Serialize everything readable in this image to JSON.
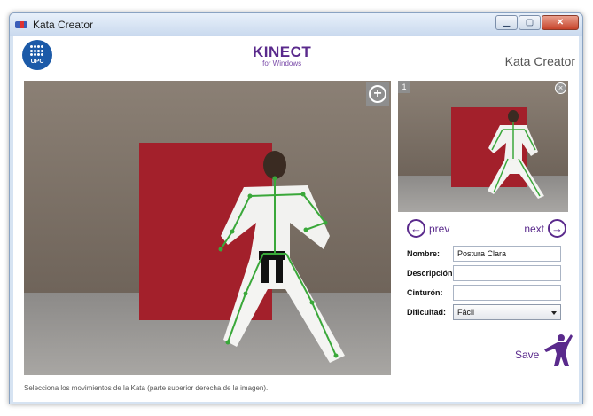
{
  "window": {
    "title": "Kata Creator",
    "controls": {
      "minimize": "▁",
      "maximize": "▢",
      "close": "✕"
    }
  },
  "header": {
    "logo_text": "UPC",
    "kinect_title": "KINECT",
    "kinect_subtitle": "for Windows",
    "app_title": "Kata Creator"
  },
  "main_view": {
    "add_icon": "plus-circle-icon",
    "add_symbol": "+"
  },
  "preview": {
    "index": "1",
    "close_symbol": "×"
  },
  "navigation": {
    "prev_label": "prev",
    "next_label": "next",
    "prev_symbol": "←",
    "next_symbol": "→"
  },
  "form": {
    "nombre_label": "Nombre:",
    "nombre_value": "Postura Clara",
    "descripcion_label": "Descripción:",
    "descripcion_value": "",
    "cinturon_label": "Cinturón:",
    "cinturon_value": "",
    "dificultad_label": "Dificultad:",
    "dificultad_value": "Fácil"
  },
  "save_label": "Save",
  "status_text": "Selecciona los movimientos de la Kata (parte superior derecha de la imagen).",
  "colors": {
    "accent": "#5a2a8c",
    "skeleton": "#3aa83a",
    "curtain": "#a3202b"
  }
}
